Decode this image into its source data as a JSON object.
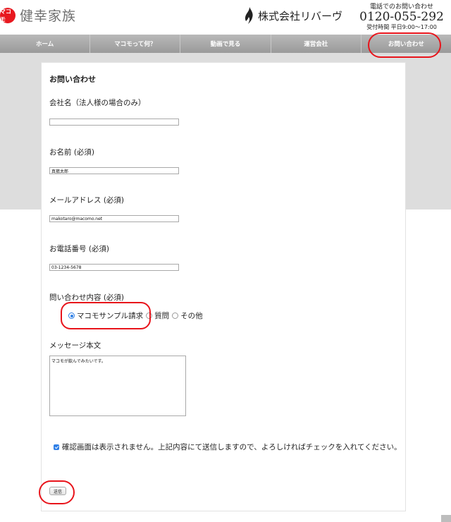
{
  "header": {
    "logo_text": "マコモ",
    "brand_name": "健幸家族",
    "company_name": "株式会社リバーヴ",
    "contact_caption": "電話でのお問い合わせ",
    "contact_phone": "0120-055-292",
    "contact_hours": "受付時間 平日9:00～17:00"
  },
  "nav": {
    "items": [
      "ホーム",
      "マコモって何？",
      "動画で見る",
      "運営会社",
      "お問い合わせ"
    ]
  },
  "form": {
    "title": "お問い合わせ",
    "company_label": "会社名（法人様の場合のみ）",
    "company_value": "",
    "name_label": "お名前 (必須)",
    "name_value": "真菰太郎",
    "email_label": "メールアドレス (必須)",
    "email_value": "makotaro@macomo.net",
    "phone_label": "お電話番号 (必須)",
    "phone_value": "03-1234-5678",
    "inquiry_label": "問い合わせ内容 (必須)",
    "inquiry_options": [
      "マコモサンプル請求",
      "質問",
      "その他"
    ],
    "inquiry_selected": "マコモサンプル請求",
    "message_label": "メッセージ本文",
    "message_value": "マコモが飲んでみたいです。",
    "confirm_text": "確認画面は表示されません。上記内容にて送信しますので、よろしければチェックを入れてください。",
    "confirm_checked": true,
    "submit_label": "送信"
  },
  "colors": {
    "accent": "#e8141b",
    "nav_bg": "#a9a9a9",
    "checkbox_blue": "#2f7fe6"
  }
}
